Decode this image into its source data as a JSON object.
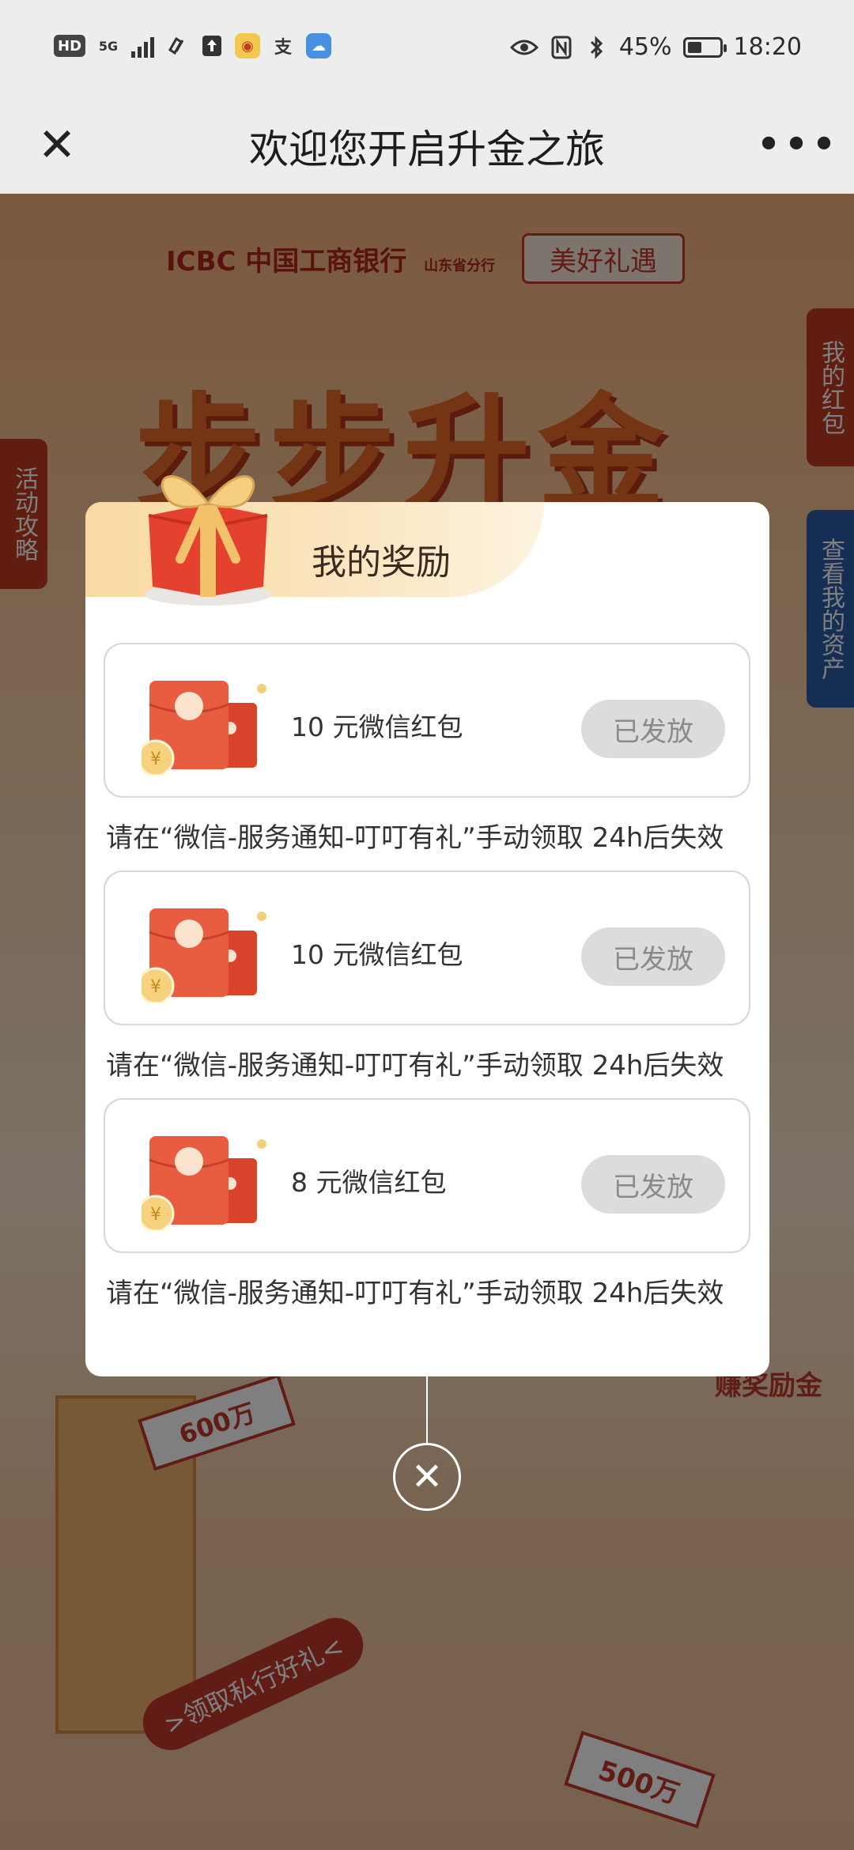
{
  "status_bar": {
    "left_icons": [
      "HD",
      "5G",
      "signal-icon",
      "link-icon",
      "upload-icon",
      "weibo-icon",
      "alipay-icon",
      "cloud-icon"
    ],
    "hd": "HD",
    "net": "5G",
    "alipay_glyph": "支",
    "battery": "45%",
    "battery_level": 0.45,
    "time": "18:20"
  },
  "nav": {
    "close_glyph": "✕",
    "title": "欢迎您开启升金之旅",
    "more_glyph": "•••"
  },
  "background": {
    "bank_logo": "ICBC 中国工商银行",
    "branch": "山东省分行",
    "badge": "美好礼遇",
    "headline": "步步升金",
    "tab_left": "活动攻略",
    "tab_right_top": "我的红包",
    "tab_right_bottom": "查看我的资产",
    "tag_600": "600万",
    "tag_500": "500万",
    "ribbon": ">领取私行好礼<",
    "right_caption": "赚奖励金"
  },
  "modal": {
    "title": "我的奖励",
    "rewards": [
      {
        "label": "10 元微信红包",
        "status": "已发放",
        "note": "请在“微信-服务通知-叮叮有礼”手动领取 24h后失效"
      },
      {
        "label": "10 元微信红包",
        "status": "已发放",
        "note": "请在“微信-服务通知-叮叮有礼”手动领取 24h后失效"
      },
      {
        "label": "8 元微信红包",
        "status": "已发放",
        "note": "请在“微信-服务通知-叮叮有礼”手动领取 24h后失效"
      }
    ],
    "close_glyph": "✕"
  },
  "colors": {
    "accent_red": "#e8563a",
    "button_disabled": "#dcdcdc",
    "header_gold": "#f9d9a2"
  }
}
